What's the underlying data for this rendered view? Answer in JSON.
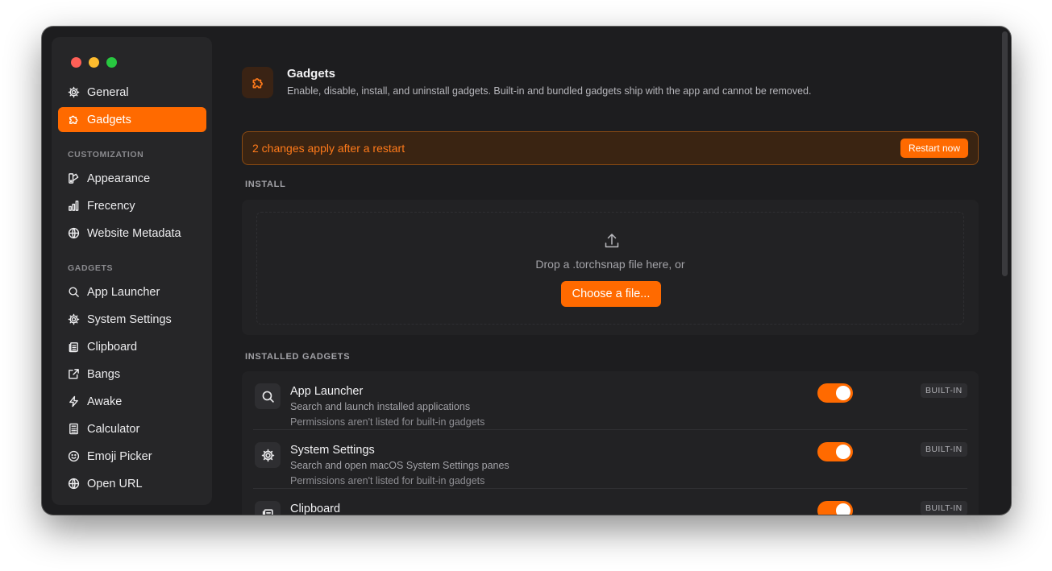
{
  "sidebar": {
    "items_top": [
      {
        "label": "General",
        "icon": "gear-icon",
        "active": false
      },
      {
        "label": "Gadgets",
        "icon": "puzzle-icon",
        "active": true
      }
    ],
    "customization_label": "CUSTOMIZATION",
    "customization_items": [
      {
        "label": "Appearance",
        "icon": "palette-icon"
      },
      {
        "label": "Frecency",
        "icon": "bar-chart-icon"
      },
      {
        "label": "Website Metadata",
        "icon": "globe-icon"
      }
    ],
    "gadgets_label": "GADGETS",
    "gadget_items": [
      {
        "label": "App Launcher",
        "icon": "search-icon"
      },
      {
        "label": "System Settings",
        "icon": "gear-icon"
      },
      {
        "label": "Clipboard",
        "icon": "clipboard-icon"
      },
      {
        "label": "Bangs",
        "icon": "external-link-icon"
      },
      {
        "label": "Awake",
        "icon": "bolt-icon"
      },
      {
        "label": "Calculator",
        "icon": "calculator-icon"
      },
      {
        "label": "Emoji Picker",
        "icon": "smiley-icon"
      },
      {
        "label": "Open URL",
        "icon": "globe-icon"
      }
    ]
  },
  "header": {
    "title": "Gadgets",
    "description": "Enable, disable, install, and uninstall gadgets. Built-in and bundled gadgets ship with the app and cannot be removed."
  },
  "banner": {
    "text": "2 changes apply after a restart",
    "button_label": "Restart now"
  },
  "install": {
    "section_label": "INSTALL",
    "drop_text": "Drop a .torchsnap file here, or",
    "button_label": "Choose a file..."
  },
  "installed": {
    "section_label": "INSTALLED GADGETS",
    "gadgets": [
      {
        "name": "App Launcher",
        "description": "Search and launch installed applications",
        "permissions": "Permissions aren't listed for built-in gadgets",
        "enabled": true,
        "badge": "BUILT-IN",
        "icon": "search-icon"
      },
      {
        "name": "System Settings",
        "description": "Search and open macOS System Settings panes",
        "permissions": "Permissions aren't listed for built-in gadgets",
        "enabled": true,
        "badge": "BUILT-IN",
        "icon": "gear-icon"
      },
      {
        "name": "Clipboard",
        "description": "",
        "permissions": "",
        "enabled": true,
        "badge": "BUILT-IN",
        "icon": "clipboard-icon"
      }
    ]
  },
  "colors": {
    "accent": "#ff6a00",
    "background": "#1d1d1f",
    "sidebar": "#262628"
  }
}
